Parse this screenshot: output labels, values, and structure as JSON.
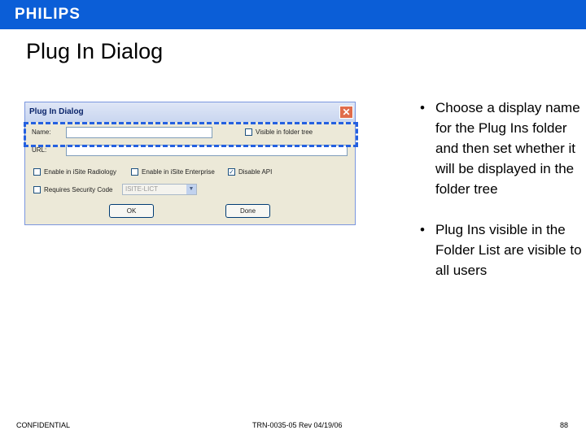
{
  "header": {
    "logo_text": "PHILIPS",
    "bar_color": "#0b5ed7"
  },
  "slide": {
    "title": "Plug In Dialog"
  },
  "dialog": {
    "title": "Plug In Dialog",
    "close_icon": "close-icon",
    "name_label": "Name:",
    "name_value": "",
    "url_label": "URL:",
    "url_value": "",
    "visible_in_folder_tree_label": "Visible in folder tree",
    "visible_in_folder_tree_checked": false,
    "enable_radiology_label": "Enable in iSite Radiology",
    "enable_radiology_checked": false,
    "enable_enterprise_label": "Enable in iSite Enterprise",
    "enable_enterprise_checked": false,
    "disable_api_label": "Disable API",
    "disable_api_checked": true,
    "requires_security_code_label": "Requires Security Code",
    "requires_security_code_checked": false,
    "security_code_value": "ISITE-LICT",
    "ok_label": "OK",
    "done_label": "Done"
  },
  "bullets": [
    "Choose a display name for the Plug Ins folder and then set whether it will be displayed in the folder tree",
    "Plug Ins visible in the Folder List are visible to all users"
  ],
  "footer": {
    "confidential": "CONFIDENTIAL",
    "doc_id": "TRN-0035-05 Rev 04/19/06",
    "page_number": "88"
  }
}
